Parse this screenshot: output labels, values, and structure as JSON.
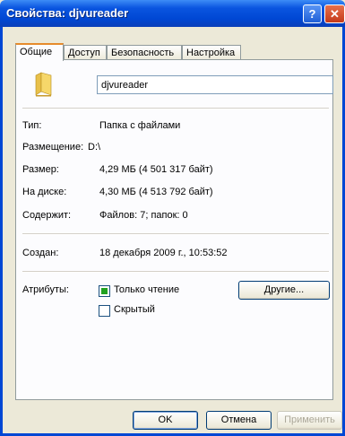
{
  "window": {
    "title": "Свойства: djvureader",
    "help_glyph": "?",
    "close_glyph": "✕"
  },
  "tabs": [
    {
      "label": "Общие"
    },
    {
      "label": "Доступ"
    },
    {
      "label": "Безопасность"
    },
    {
      "label": "Настройка"
    }
  ],
  "general": {
    "folder_name": "djvureader",
    "type_label": "Тип:",
    "type_value": "Папка с файлами",
    "location_label": "Размещение:",
    "location_value": "D:\\",
    "size_label": "Размер:",
    "size_value": "4,29 МБ (4 501 317 байт)",
    "disk_size_label": "На диске:",
    "disk_size_value": "4,30 МБ (4 513 792 байт)",
    "contains_label": "Содержит:",
    "contains_value": "Файлов: 7; папок: 0",
    "created_label": "Создан:",
    "created_value": "18 декабря 2009 г., 10:53:52",
    "attributes_label": "Атрибуты:",
    "readonly_label": "Только чтение",
    "hidden_label": "Скрытый",
    "advanced_button": "Другие..."
  },
  "buttons": {
    "ok": "OK",
    "cancel": "Отмена",
    "apply": "Применить"
  },
  "colors": {
    "title_bar": "#0047d4",
    "tab_highlight": "#e68b2c",
    "check_mixed": "#21a121"
  },
  "icons": {
    "folder": "folder-icon",
    "help": "help-icon",
    "close": "close-icon"
  },
  "checkboxes": {
    "readonly_state": "mixed",
    "hidden_checked": false
  }
}
